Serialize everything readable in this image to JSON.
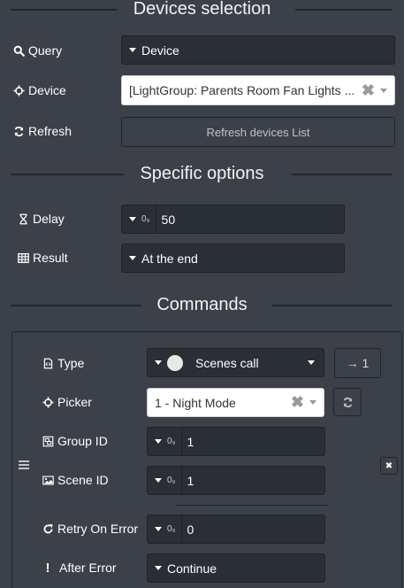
{
  "sections": {
    "devices_selection": "Devices selection",
    "specific_options": "Specific options",
    "commands": "Commands"
  },
  "query": {
    "label": "Query",
    "value": "Device"
  },
  "device": {
    "label": "Device",
    "value": "[LightGroup: Parents Room Fan Lights ..."
  },
  "refresh": {
    "label": "Refresh",
    "button": "Refresh devices List"
  },
  "delay": {
    "label": "Delay",
    "prefix": "0₉",
    "value": "50"
  },
  "result": {
    "label": "Result",
    "value": "At the end"
  },
  "command": {
    "type": {
      "label": "Type",
      "value": "Scenes call",
      "arrow_button": "→ 1"
    },
    "picker": {
      "label": "Picker",
      "value": "1 - Night Mode"
    },
    "group_id": {
      "label": "Group ID",
      "value": "1"
    },
    "scene_id": {
      "label": "Scene ID",
      "value": "1"
    },
    "retry_on_error": {
      "label": "Retry On Error",
      "value": "0"
    },
    "after_error": {
      "label": "After Error",
      "value": "Continue"
    },
    "num_prefix": "0₉",
    "remove_button": "✖"
  },
  "colors": {
    "background": "#3b4049",
    "control_dark": "#2a2e35",
    "divider": "#22262c"
  }
}
